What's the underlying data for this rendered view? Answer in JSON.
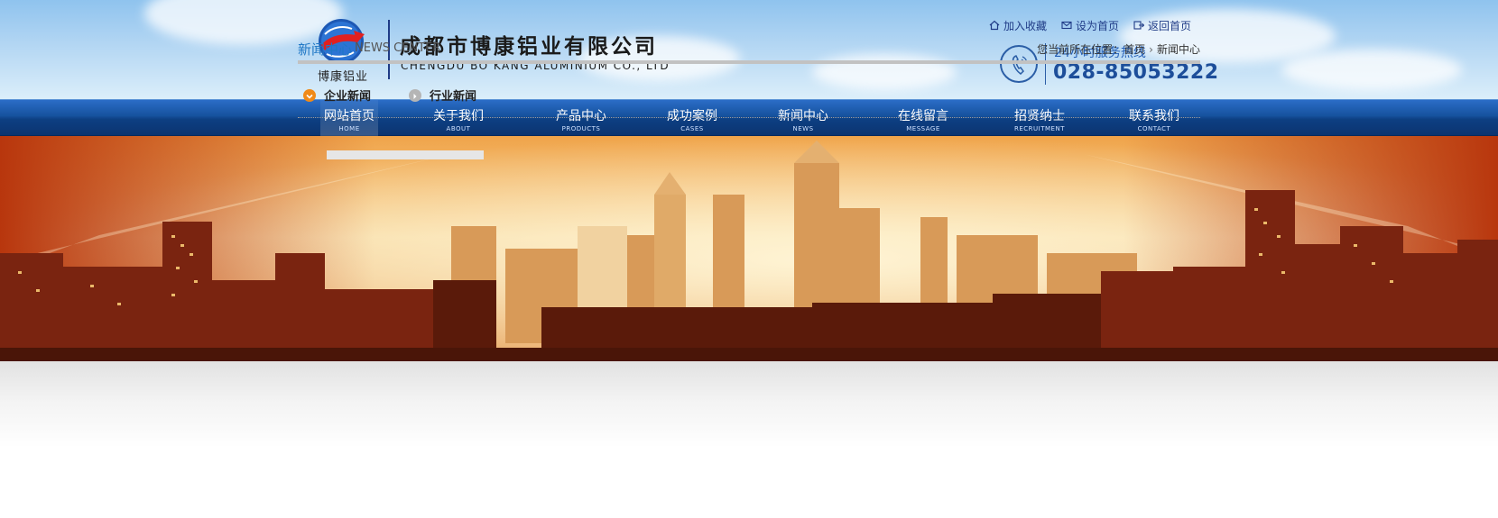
{
  "header": {
    "logo_text": "博康铝业",
    "company_cn": "成都市博康铝业有限公司",
    "company_en": "CHENGDU BO KANG ALUMINIUM CO., LTD",
    "top_links": [
      {
        "label": "加入收藏",
        "icon": "home-icon"
      },
      {
        "label": "设为首页",
        "icon": "mail-icon"
      },
      {
        "label": "返回首页",
        "icon": "return-icon"
      }
    ],
    "hotline_label": "24小时服务热线",
    "hotline_number": "028-85053222"
  },
  "nav": {
    "items": [
      {
        "cn": "网站首页",
        "en": "HOME",
        "active": true
      },
      {
        "cn": "关于我们",
        "en": "ABOUT"
      },
      {
        "cn": "产品中心",
        "en": "PRODUCTS"
      },
      {
        "cn": "成功案例",
        "en": "CASES"
      },
      {
        "cn": "新闻中心",
        "en": "NEWS"
      },
      {
        "cn": "在线留言",
        "en": "MESSAGE"
      },
      {
        "cn": "招贤纳士",
        "en": "RECRUITMENT"
      },
      {
        "cn": "联系我们",
        "en": "CONTACT"
      }
    ]
  },
  "content": {
    "section_cn": "新闻中心",
    "section_en": "NEWS CENTER",
    "breadcrumb": {
      "prefix": "您当前所在位置：",
      "home": "首页",
      "current": "新闻中心"
    },
    "subtabs": [
      {
        "label": "企业新闻",
        "icon": "orange-arrow-icon",
        "active": true
      },
      {
        "label": "行业新闻",
        "icon": "gray-arrow-icon"
      }
    ]
  },
  "colors": {
    "nav_blue": "#0d3f82",
    "accent_blue": "#1f77c5",
    "subtab_active": "#f08a18"
  }
}
